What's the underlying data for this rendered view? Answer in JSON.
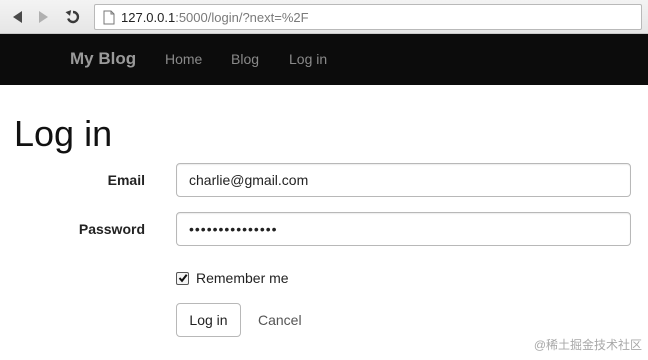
{
  "browser": {
    "url_host": "127.0.0.1",
    "url_rest": ":5000/login/?next=%2F",
    "icons": {
      "back": "back-arrow-icon",
      "forward": "forward-arrow-icon",
      "reload": "reload-icon",
      "page": "page-icon"
    }
  },
  "navbar": {
    "brand": "My Blog",
    "links": [
      "Home",
      "Blog",
      "Log in"
    ]
  },
  "form": {
    "title": "Log in",
    "email_label": "Email",
    "email_value": "charlie@gmail.com",
    "password_label": "Password",
    "password_value": "•••••••••••••••",
    "remember_label": "Remember me",
    "remember_checked": true,
    "submit_label": "Log in",
    "cancel_label": "Cancel"
  },
  "watermark": "@稀土掘金技术社区",
  "colors": {
    "navbar_bg": "#0c0c0c",
    "navbar_text": "#8a8a8a"
  }
}
